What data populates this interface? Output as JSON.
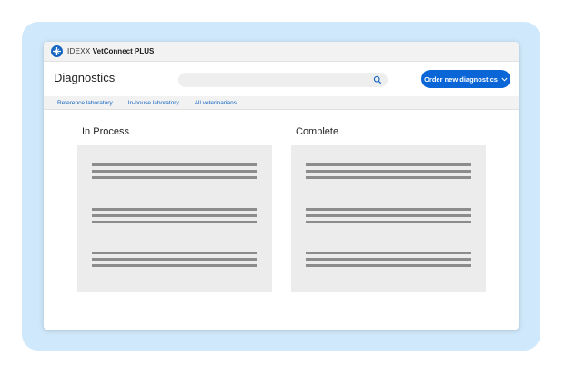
{
  "brand": {
    "prefix": "IDEXX",
    "product": "VetConnect PLUS"
  },
  "header": {
    "title": "Diagnostics",
    "search_placeholder": "",
    "order_button_label": "Order new diagnostics"
  },
  "tabs": [
    {
      "label": "Reference laboratory"
    },
    {
      "label": "In-house laboratory"
    },
    {
      "label": "All veterinarians"
    }
  ],
  "sections": [
    {
      "title": "In Process"
    },
    {
      "title": "Complete"
    }
  ],
  "colors": {
    "accent": "#0a66d6",
    "frame": "#cfe8fb",
    "panel": "#ececec"
  },
  "icons": [
    "idexx-logo-icon",
    "search-icon",
    "chevron-down-icon"
  ]
}
